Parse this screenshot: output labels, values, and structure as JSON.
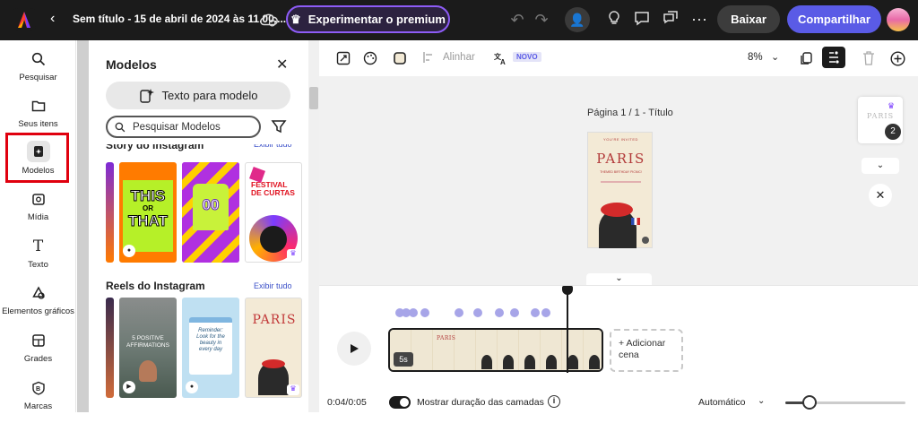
{
  "header": {
    "doc_title": "Sem título - 15 de abril de 2024 às 11.00....",
    "premium_label": "Experimentar o premium",
    "download_label": "Baixar",
    "share_label": "Compartilhar"
  },
  "rail": {
    "items": [
      {
        "label": "Pesquisar",
        "icon": "search-icon"
      },
      {
        "label": "Seus itens",
        "icon": "folder-icon"
      },
      {
        "label": "Modelos",
        "icon": "templates-icon",
        "active": true
      },
      {
        "label": "Mídia",
        "icon": "media-icon"
      },
      {
        "label": "Texto",
        "icon": "text-icon"
      },
      {
        "label": "Elementos gráficos",
        "icon": "shapes-icon"
      },
      {
        "label": "Grades",
        "icon": "grid-icon"
      },
      {
        "label": "Marcas",
        "icon": "brand-icon"
      }
    ]
  },
  "panel": {
    "title": "Modelos",
    "text_to_template": "Texto para modelo",
    "search_placeholder": "Pesquisar Modelos",
    "section1": {
      "title": "Story do Instagram",
      "see_all": "Exibir tudo"
    },
    "section2": {
      "title": "Reels do Instagram",
      "see_all": "Exibir tudo"
    },
    "thumbs": {
      "t1a": "THIS",
      "t1b": "OR",
      "t1c": "THAT",
      "t2": "00",
      "t3a": "FESTIVAL",
      "t3b": "DE CURTAS",
      "t4a": "5 POSITIVE",
      "t4b": "AFFIRMATIONS",
      "t5": "Reminder: Look for the beauty in every day",
      "t6": "PARIS"
    }
  },
  "toolbar": {
    "align_label": "Alinhar",
    "new_badge": "NOVO",
    "zoom": "8%"
  },
  "canvas": {
    "page_label": "Página 1 / 1 - Título",
    "poster_top": "YOU'RE INVITED",
    "poster_title": "PARIS",
    "poster_sub": "THEMED BIRTHDAY PICNIC!",
    "page_count": "2"
  },
  "timeline": {
    "clip_length": "5s",
    "add_scene": "+ Adicionar cena",
    "time": "0:04/0:05",
    "toggle_label": "Mostrar duração das camadas",
    "playback": "Automático",
    "volume_fraction": 0.2
  },
  "colors": {
    "accent": "#5a5be6",
    "premium_border": "#8d5cf6",
    "highlight": "#e0000e",
    "topbar": "#1b1b1b"
  }
}
